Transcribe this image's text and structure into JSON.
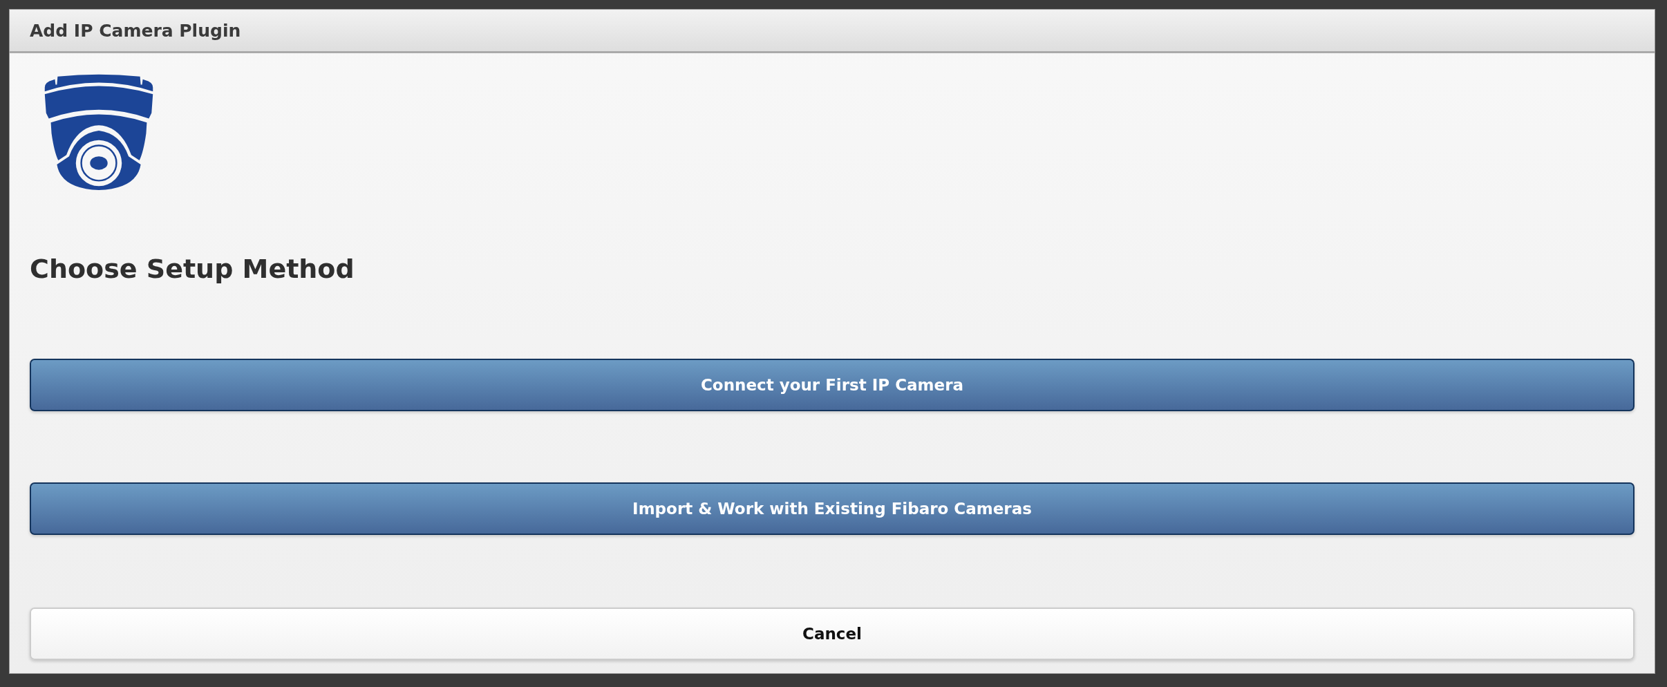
{
  "dialog": {
    "title": "Add IP Camera Plugin"
  },
  "heading": "Choose Setup Method",
  "buttons": [
    {
      "label": "Connect your First IP Camera",
      "kind": "primary"
    },
    {
      "label": "Import & Work with Existing Fibaro Cameras",
      "kind": "primary"
    },
    {
      "label": "Cancel",
      "kind": "default"
    }
  ]
}
